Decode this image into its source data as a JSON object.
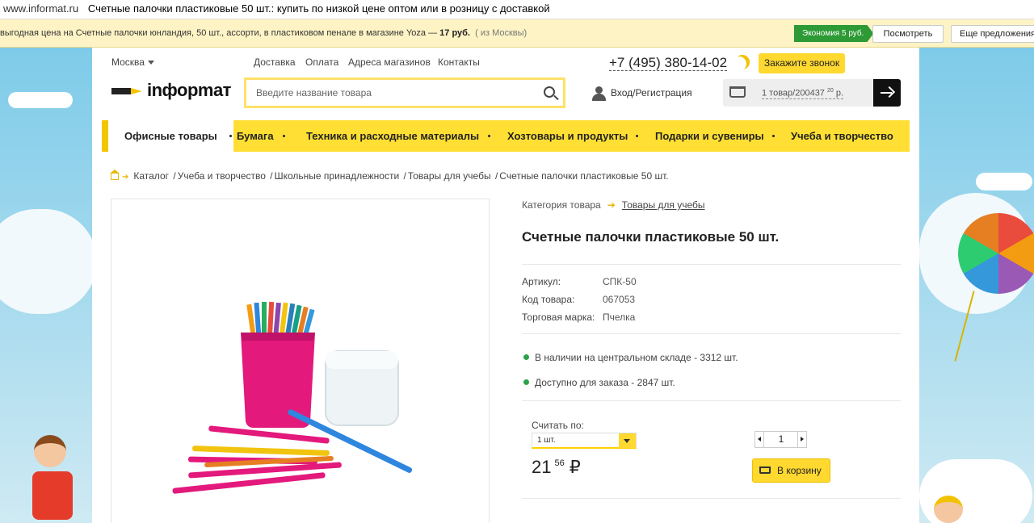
{
  "browser": {
    "domain": "www.informat.ru",
    "title": "Счетные палочки пластиковые 50 шт.: купить по низкой цене оптом или в розницу с доставкой"
  },
  "ad": {
    "text_prefix": "выгодная цена на Счетные палочки юнландия, 50 шт., ассорти, в пластиковом пенале в магазине Yoza — ",
    "price": "17 руб.",
    "from": "( из Москвы)",
    "economy": "Экономия 5 руб.",
    "look": "Посмотреть",
    "more": "Еще предложения"
  },
  "header": {
    "city": "Москва",
    "nav": [
      "Доставка",
      "Оплата",
      "Адреса магазинов",
      "Контакты"
    ],
    "phone": "+7 (495) 380-14-02",
    "call_button": "Закажите звонок",
    "logo": "inфорmат",
    "search_placeholder": "Введите название товара",
    "login": "Вход/Регистрация",
    "cart_text": "1 товар/200437",
    "cart_kop": "20",
    "cart_cur": "р."
  },
  "categories": [
    "Офисные товары",
    "Бумага",
    "Техника и расходные материалы",
    "Хозтовары и продукты",
    "Подарки и сувениры",
    "Учеба и творчество"
  ],
  "breadcrumbs": [
    "Каталог",
    "Учеба и творчество",
    "Школьные принадлежности",
    "Товары для учебы",
    "Счетные палочки пластиковые 50 шт."
  ],
  "product": {
    "category_label": "Категория товара",
    "category_link": "Товары для учебы",
    "title": "Счетные палочки пластиковые 50 шт.",
    "props": [
      {
        "label": "Артикул:",
        "value": "СПК-50"
      },
      {
        "label": "Код товара:",
        "value": "067053"
      },
      {
        "label": "Торговая марка:",
        "value": "Пчелка"
      }
    ],
    "stock": [
      "В наличии на центральном складе - 3312 шт.",
      "Доступно для заказа - 2847 шт."
    ],
    "count_label": "Считать по:",
    "count_value": "1 шт.",
    "price_rub": "21",
    "price_kop": "56",
    "currency": "₽",
    "qty": "1",
    "to_cart": "В корзину"
  }
}
